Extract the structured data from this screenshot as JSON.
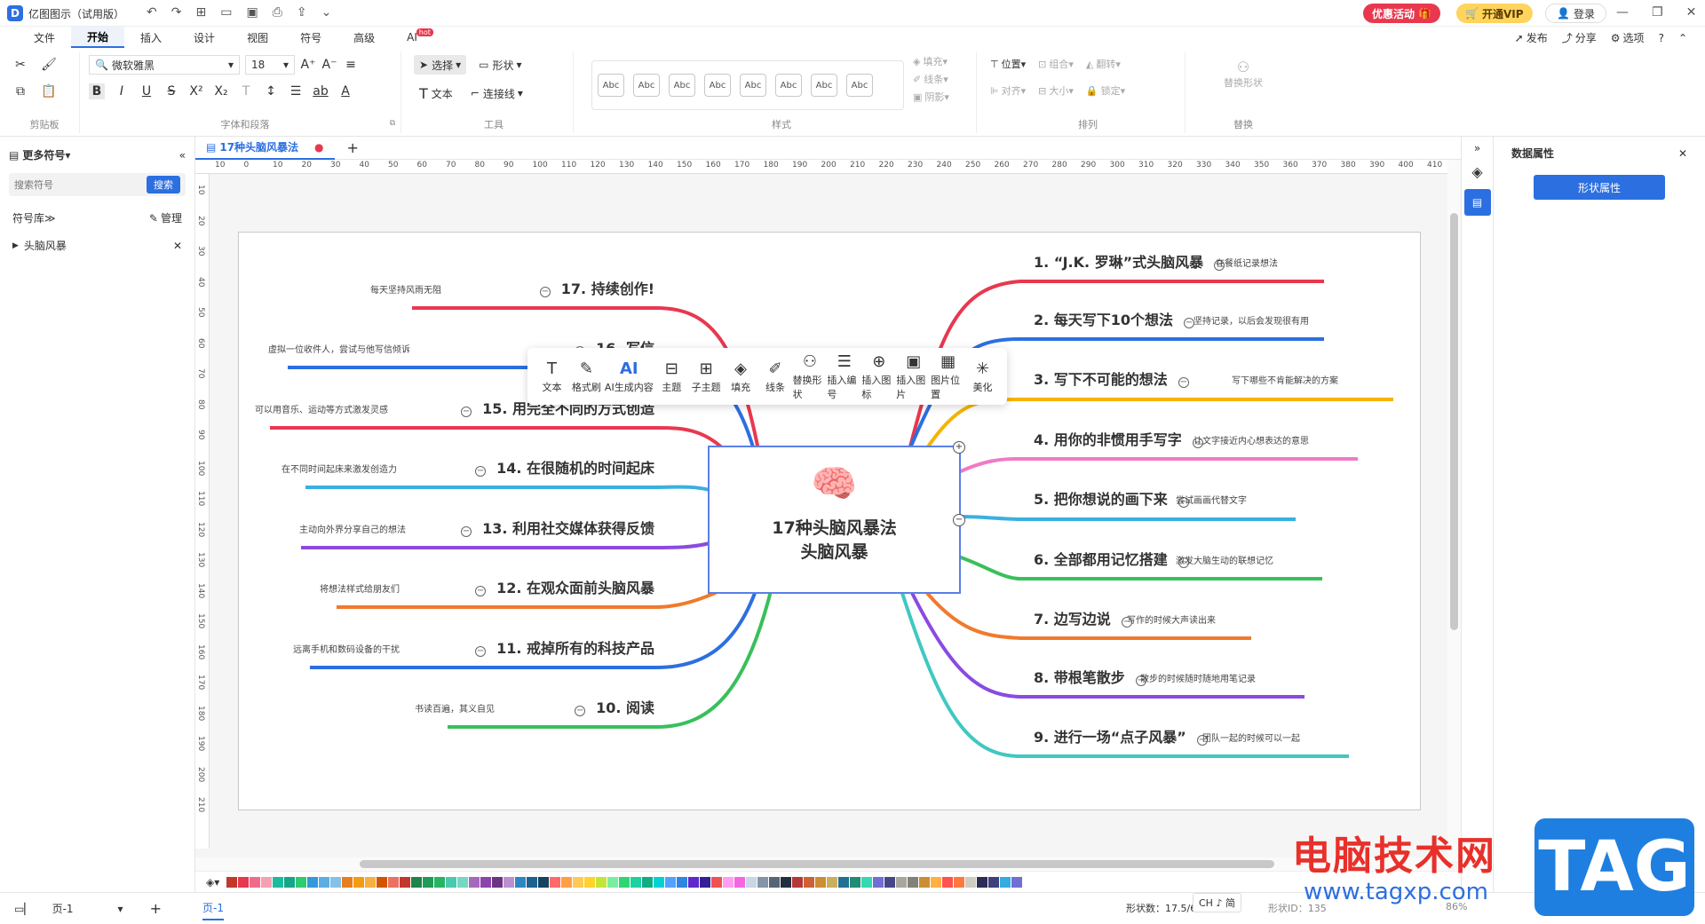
{
  "app": {
    "title": "亿图图示（试用版）",
    "promo_label": "优惠活动",
    "vip_label": "开通VIP",
    "login_label": "登录"
  },
  "menu": {
    "items": [
      "文件",
      "开始",
      "插入",
      "设计",
      "视图",
      "符号",
      "高级",
      "AI"
    ],
    "ai_badge": "hot",
    "right": [
      "发布",
      "分享",
      "选项"
    ]
  },
  "ribbon": {
    "font_name": "微软雅黑",
    "font_size": "18",
    "select_label": "选择",
    "shape_label": "形状",
    "text_label": "文本",
    "connector_label": "连接线",
    "style_sample": "Abc",
    "fill_label": "填充",
    "line_label": "线条",
    "shadow_label": "阴影",
    "position_label": "位置",
    "group_label": "组合",
    "flip_label": "翻转",
    "align_label": "对齐",
    "size_label": "大小",
    "lock_label": "锁定",
    "replace_shape_label": "替换形状",
    "groups": {
      "clipboard": "剪贴板",
      "font": "字体和段落",
      "tools": "工具",
      "styles": "样式",
      "arrange": "排列",
      "replace": "替换"
    }
  },
  "left_panel": {
    "title": "更多符号",
    "search_placeholder": "搜索符号",
    "search_button": "搜索",
    "library_label": "符号库",
    "manage_label": "管理",
    "tree_item": "头脑风暴"
  },
  "tabs": {
    "active": "17种头脑风暴法"
  },
  "ruler": {
    "h": [
      "10",
      "0",
      "10",
      "20",
      "30",
      "40",
      "50",
      "60",
      "70",
      "80",
      "90",
      "100",
      "110",
      "120",
      "130",
      "140",
      "150",
      "160",
      "170",
      "180",
      "190",
      "200",
      "210",
      "220",
      "230",
      "240",
      "250",
      "260",
      "270",
      "280",
      "290",
      "300",
      "310",
      "320",
      "330",
      "340",
      "350",
      "360",
      "370",
      "380",
      "390",
      "400",
      "410"
    ],
    "v": [
      "10",
      "20",
      "30",
      "40",
      "50",
      "60",
      "70",
      "80",
      "90",
      "100",
      "110",
      "120",
      "130",
      "140",
      "150",
      "160",
      "170",
      "180",
      "190",
      "200",
      "210"
    ]
  },
  "mindmap": {
    "center_line1": "17种头脑风暴法",
    "center_line2": "头脑风暴",
    "right": [
      {
        "title": "1. “J.K. 罗琳”式头脑风暴",
        "note": "在餐纸记录想法",
        "color": "#e8384f"
      },
      {
        "title": "2. 每天写下10个想法",
        "note": "坚持记录，以后会发现很有用",
        "color": "#2c6fe0"
      },
      {
        "title": "3. 写下不可能的想法",
        "note": "写下哪些不肯能解决的方案",
        "color": "#f5b400"
      },
      {
        "title": "4. 用你的非惯用手写字",
        "note": "让文字接近内心想表达的意思",
        "color": "#f07ac4"
      },
      {
        "title": "5. 把你想说的画下来",
        "note": "尝试画画代替文字",
        "color": "#3ab0e0"
      },
      {
        "title": "6. 全部都用记忆搭建",
        "note": "激发大脑生动的联想记忆",
        "color": "#38c05a"
      },
      {
        "title": "7. 边写边说",
        "note": "写作的时候大声读出来",
        "color": "#f07a2c"
      },
      {
        "title": "8. 带根笔散步",
        "note": "散步的时候随时随地用笔记录",
        "color": "#8a4be0"
      },
      {
        "title": "9. 进行一场“点子风暴”",
        "note": "团队一起的时候可以一起",
        "color": "#40c8c0"
      }
    ],
    "left": [
      {
        "title": "17. 持续创作!",
        "note": "每天坚持风雨无阻",
        "color": "#e8384f"
      },
      {
        "title": "16. 写信",
        "note": "虚拟一位收件人，尝试与他写信倾诉",
        "color": "#2c6fe0"
      },
      {
        "title": "15. 用完全不同的方式创造",
        "note": "可以用音乐、运动等方式激发灵感",
        "color": "#e8384f"
      },
      {
        "title": "14. 在很随机的时间起床",
        "note": "在不同时间起床来激发创造力",
        "color": "#3ab0e0"
      },
      {
        "title": "13. 利用社交媒体获得反馈",
        "note": "主动向外界分享自己的想法",
        "color": "#8a4be0"
      },
      {
        "title": "12. 在观众面前头脑风暴",
        "note": "将想法样式给朋友们",
        "color": "#f07a2c"
      },
      {
        "title": "11. 戒掉所有的科技产品",
        "note": "远离手机和数码设备的干扰",
        "color": "#2c6fe0"
      },
      {
        "title": "10. 阅读",
        "note": "书读百遍，其义自见",
        "color": "#38c05a"
      }
    ]
  },
  "floating_toolbar": [
    {
      "icon": "text-icon",
      "glyph": "T",
      "label": "文本"
    },
    {
      "icon": "format-brush-icon",
      "glyph": "✎",
      "label": "格式刷"
    },
    {
      "icon": "ai-icon",
      "glyph": "AI",
      "label": "AI生成内容"
    },
    {
      "icon": "topic-icon",
      "glyph": "⊟",
      "label": "主题"
    },
    {
      "icon": "subtopic-icon",
      "glyph": "⊞",
      "label": "子主题"
    },
    {
      "icon": "fill-icon",
      "glyph": "◈",
      "label": "填充"
    },
    {
      "icon": "line-icon",
      "glyph": "✐",
      "label": "线条"
    },
    {
      "icon": "replace-shape-icon",
      "glyph": "⚇",
      "label": "替换形状"
    },
    {
      "icon": "numbering-icon",
      "glyph": "☰",
      "label": "插入编号"
    },
    {
      "icon": "insert-icon-icon",
      "glyph": "⊕",
      "label": "插入图标"
    },
    {
      "icon": "insert-image-icon",
      "glyph": "▣",
      "label": "插入图片"
    },
    {
      "icon": "image-position-icon",
      "glyph": "▦",
      "label": "图片位置"
    },
    {
      "icon": "beautify-icon",
      "glyph": "✳",
      "label": "美化"
    }
  ],
  "right_panel": {
    "title": "数据属性",
    "shape_props_button": "形状属性"
  },
  "status": {
    "page_label": "页-1",
    "page_tab": "页-1",
    "shape_count": "形状数：17.5/60",
    "shape_id": "形状ID：135",
    "ime": "CH ♪ 简",
    "zoom": "86%"
  },
  "watermark": {
    "text": "电脑技术网",
    "url": "www.tagxp.com",
    "logo": "TAG"
  },
  "palette": [
    "#c0392b",
    "#e8384f",
    "#f06a8a",
    "#f5a0b5",
    "#1abc9c",
    "#17a589",
    "#2ecc71",
    "#3498db",
    "#5dade2",
    "#85c1e9",
    "#e67e22",
    "#f39c12",
    "#f5b041",
    "#d35400",
    "#ec7063",
    "#c0392b",
    "#1e8449",
    "#239b56",
    "#28b463",
    "#48c9b0",
    "#76d7c4",
    "#a569bd",
    "#8e44ad",
    "#6c3483",
    "#bb8fce",
    "#2e86c1",
    "#1f618d",
    "#154360",
    "#ff6b6b",
    "#ff9f43",
    "#feca57",
    "#ffd32a",
    "#c4e538",
    "#7bed9f",
    "#2ed573",
    "#1dd1a1",
    "#10ac84",
    "#00d2d3",
    "#54a0ff",
    "#2e86de",
    "#5f27cd",
    "#341f97",
    "#ee5253",
    "#ff9ff3",
    "#f368e0",
    "#c8d6e5",
    "#8395a7",
    "#576574",
    "#222f3e",
    "#b33939",
    "#cd6133",
    "#cc8e35",
    "#ccae62",
    "#227093",
    "#218c74",
    "#33d9b2",
    "#706fd3",
    "#474787",
    "#aaa69d",
    "#84817a",
    "#cc8e35",
    "#ffb142",
    "#ff5252",
    "#ff793f",
    "#d1ccc0",
    "#2c2c54",
    "#40407a",
    "#34ace0",
    "#706fd3"
  ]
}
